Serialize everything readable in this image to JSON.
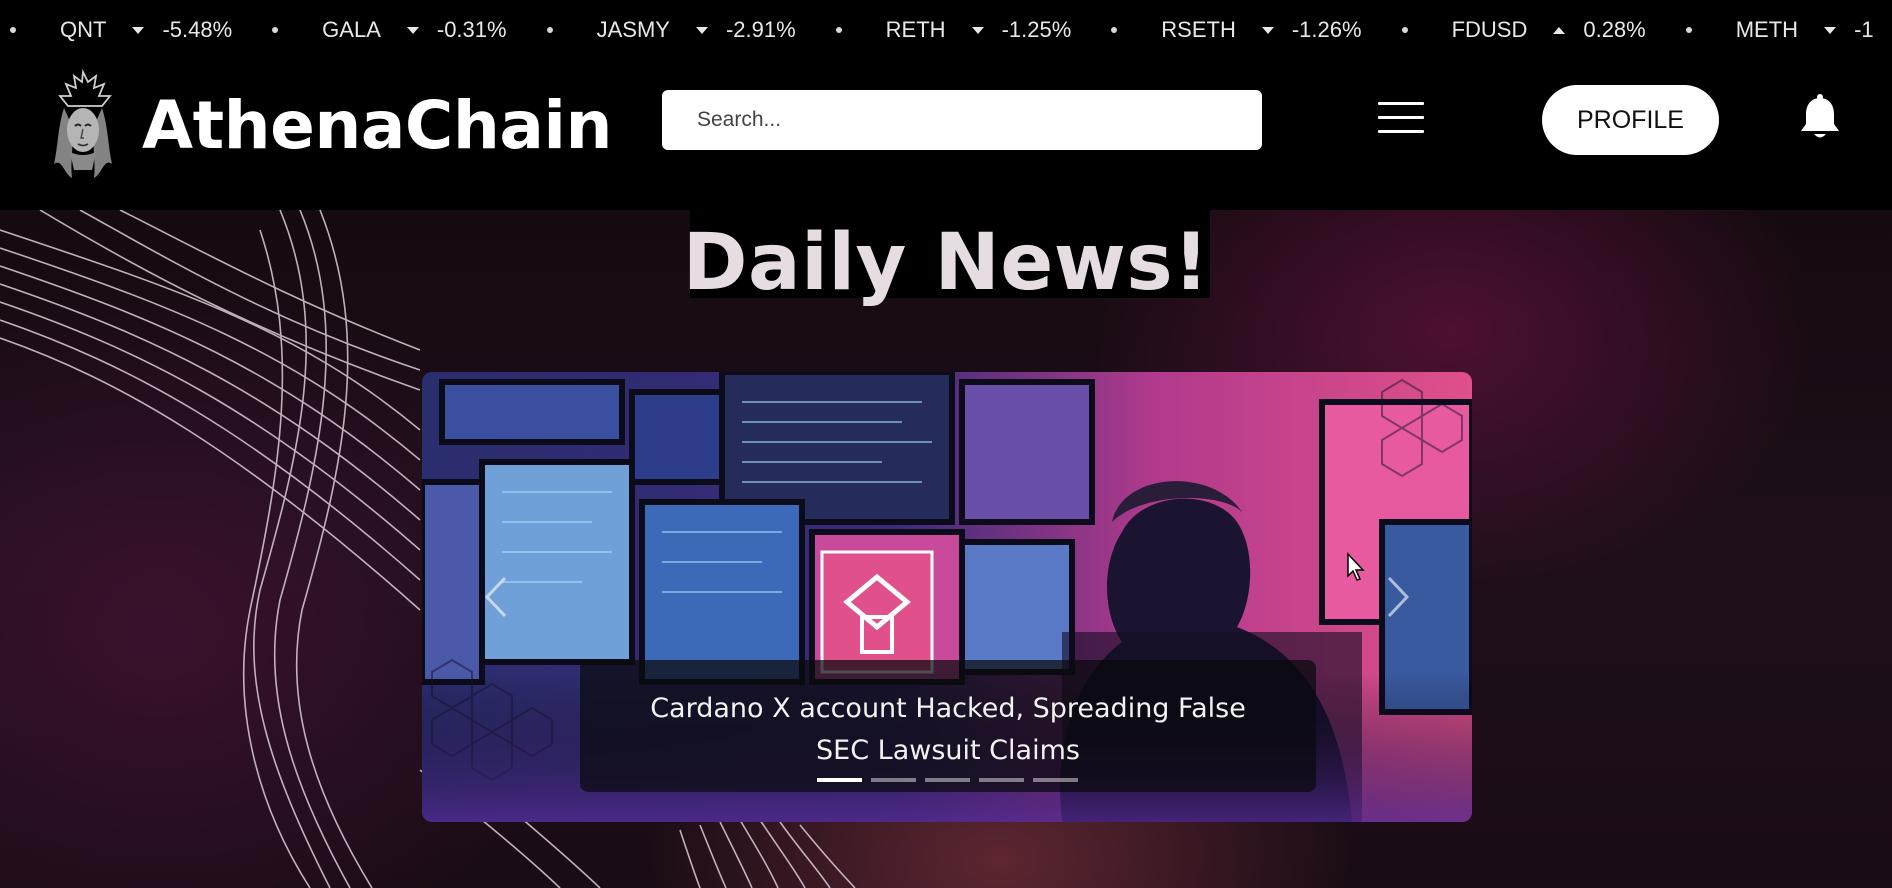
{
  "ticker": [
    {
      "symbol": "QNT",
      "direction": "down",
      "change": "-5.48%"
    },
    {
      "symbol": "GALA",
      "direction": "down",
      "change": "-0.31%"
    },
    {
      "symbol": "JASMY",
      "direction": "down",
      "change": "-2.91%"
    },
    {
      "symbol": "RETH",
      "direction": "down",
      "change": "-1.25%"
    },
    {
      "symbol": "RSETH",
      "direction": "down",
      "change": "-1.26%"
    },
    {
      "symbol": "FDUSD",
      "direction": "up",
      "change": "0.28%"
    },
    {
      "symbol": "METH",
      "direction": "down",
      "change": "-1"
    }
  ],
  "header": {
    "brand": "AthenaChain",
    "logo_icon": "athena-head-icon",
    "search_placeholder": "Search...",
    "menu_icon": "hamburger-icon",
    "profile_label": "PROFILE",
    "notification_icon": "bell-icon"
  },
  "main": {
    "title": "Daily News!",
    "carousel": {
      "caption": "Cardano X account Hacked, Spreading False SEC Lawsuit Claims",
      "slide_count": 5,
      "active_index": 0,
      "prev_icon": "chevron-left-icon",
      "next_icon": "chevron-right-icon"
    }
  },
  "colors": {
    "background": "#000000",
    "title": "#e6dde2",
    "accent_pink": "#e0508a",
    "accent_purple": "#4a3a8a"
  }
}
